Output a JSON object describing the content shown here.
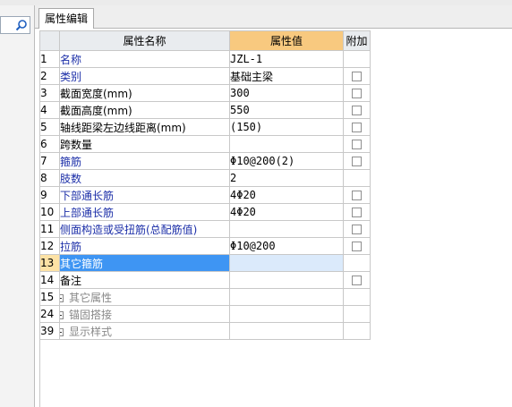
{
  "tab": {
    "label": "属性编辑"
  },
  "grid": {
    "headers": {
      "name": "属性名称",
      "value": "属性值",
      "extra": "附加"
    },
    "rows": [
      {
        "num": "1",
        "name": "名称",
        "value": "JZL-1",
        "blue": true,
        "checkbox": false
      },
      {
        "num": "2",
        "name": "类别",
        "value": "基础主梁",
        "blue": true,
        "checkbox": true
      },
      {
        "num": "3",
        "name": "截面宽度(mm)",
        "value": "300",
        "blue": false,
        "checkbox": true
      },
      {
        "num": "4",
        "name": "截面高度(mm)",
        "value": "550",
        "blue": false,
        "checkbox": true
      },
      {
        "num": "5",
        "name": "轴线距梁左边线距离(mm)",
        "value": "(150)",
        "blue": false,
        "checkbox": true
      },
      {
        "num": "6",
        "name": "跨数量",
        "value": "",
        "blue": false,
        "checkbox": true
      },
      {
        "num": "7",
        "name": "箍筋",
        "value": "Φ10@200(2)",
        "blue": true,
        "checkbox": true
      },
      {
        "num": "8",
        "name": "肢数",
        "value": "2",
        "blue": true,
        "checkbox": false
      },
      {
        "num": "9",
        "name": "下部通长筋",
        "value": "4Φ20",
        "blue": true,
        "checkbox": true
      },
      {
        "num": "10",
        "name": "上部通长筋",
        "value": "4Φ20",
        "blue": true,
        "checkbox": true
      },
      {
        "num": "11",
        "name": "侧面构造或受扭筋(总配筋值)",
        "value": "",
        "blue": true,
        "checkbox": true
      },
      {
        "num": "12",
        "name": "拉筋",
        "value": "Φ10@200",
        "blue": true,
        "checkbox": true
      },
      {
        "num": "13",
        "name": "其它箍筋",
        "value": "",
        "blue": false,
        "checkbox": false,
        "selected": true
      },
      {
        "num": "14",
        "name": "备注",
        "value": "",
        "blue": false,
        "checkbox": true
      },
      {
        "num": "15",
        "name": "其它属性",
        "value": "",
        "group": true
      },
      {
        "num": "24",
        "name": "锚固搭接",
        "value": "",
        "group": true
      },
      {
        "num": "39",
        "name": "显示样式",
        "value": "",
        "group": true
      }
    ]
  },
  "icons": {
    "search": "search-icon",
    "expand": "plus-expand-icon"
  }
}
